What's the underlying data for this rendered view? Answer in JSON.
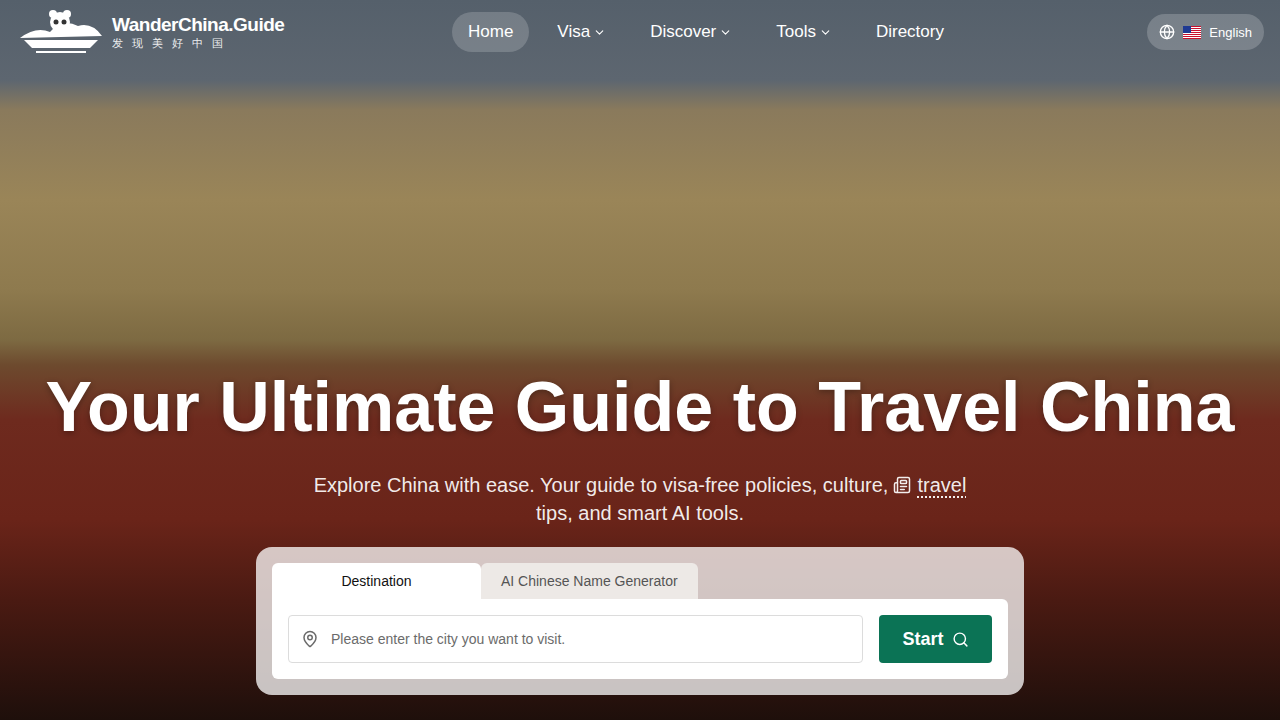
{
  "header": {
    "logo": {
      "title": "WanderChina.Guide",
      "tagline": "发 现 美 好 中 国"
    },
    "nav": [
      {
        "label": "Home",
        "selected": true,
        "dropdown": false
      },
      {
        "label": "Visa",
        "selected": false,
        "dropdown": true
      },
      {
        "label": "Discover",
        "selected": false,
        "dropdown": true
      },
      {
        "label": "Tools",
        "selected": false,
        "dropdown": true
      },
      {
        "label": "Directory",
        "selected": false,
        "dropdown": false
      }
    ],
    "language": {
      "label": "English"
    }
  },
  "hero": {
    "title": "Your Ultimate Guide to Travel China",
    "subtitle": {
      "before": "Explore China with ease. Your guide to visa-free policies, culture,",
      "link": "travel",
      "after": "tips, and smart AI tools."
    }
  },
  "search": {
    "tabs": [
      {
        "label": "Destination",
        "selected": true
      },
      {
        "label": "AI Chinese Name Generator",
        "selected": false
      }
    ],
    "placeholder": "Please enter the city you want to visit.",
    "button": "Start"
  }
}
